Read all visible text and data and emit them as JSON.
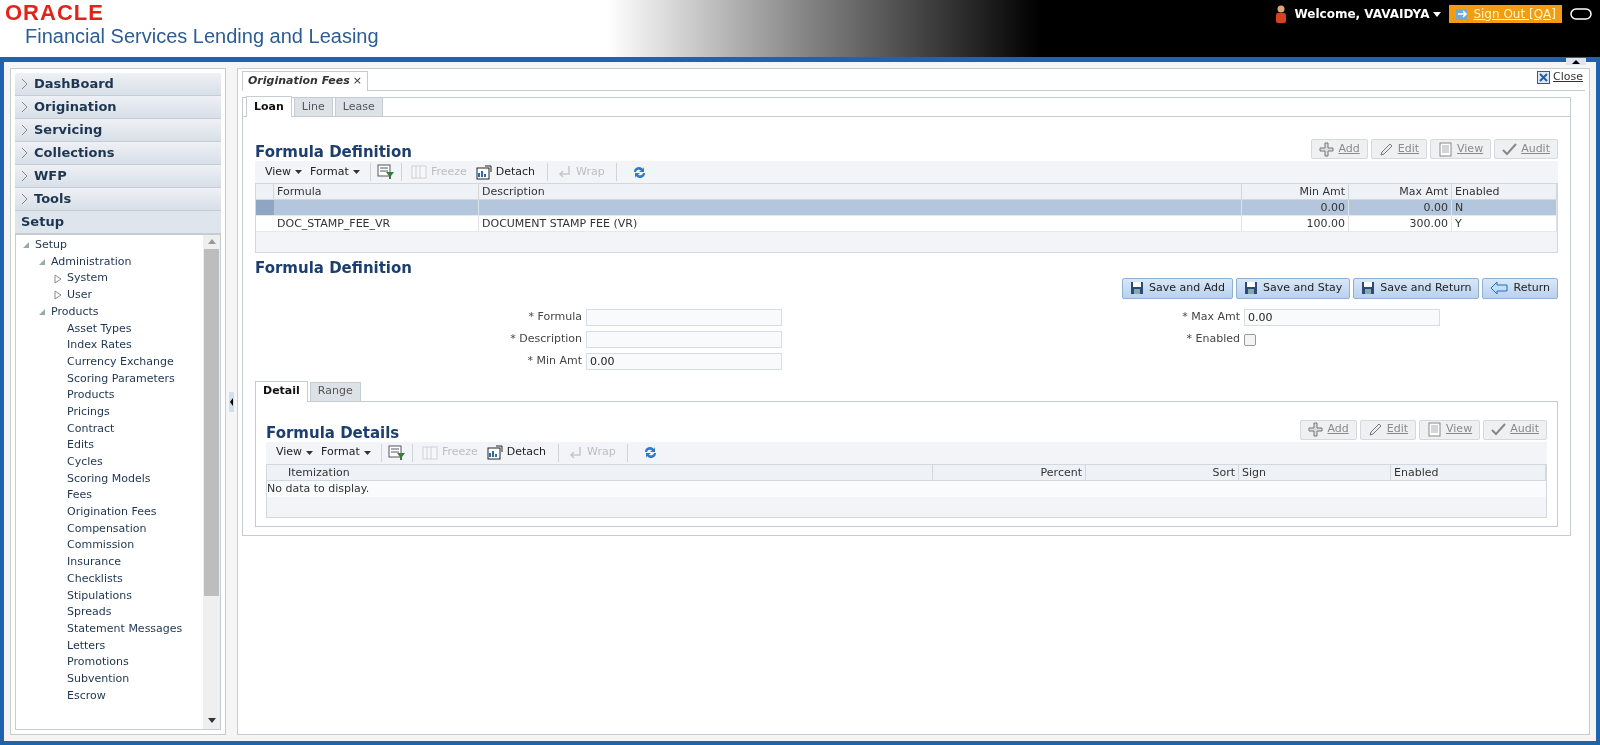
{
  "header": {
    "logo": "ORACLE",
    "product": "Financial Services Lending and Leasing",
    "welcome": "Welcome, VAVAIDYA",
    "sign_out": "Sign Out [QA]"
  },
  "sidebar": {
    "sections": [
      {
        "label": "DashBoard",
        "expanded": false
      },
      {
        "label": "Origination",
        "expanded": false
      },
      {
        "label": "Servicing",
        "expanded": false
      },
      {
        "label": "Collections",
        "expanded": false
      },
      {
        "label": "WFP",
        "expanded": false
      },
      {
        "label": "Tools",
        "expanded": false
      },
      {
        "label": "Setup",
        "expanded": true
      }
    ],
    "tree": [
      {
        "label": "Setup",
        "expanded": true,
        "children": [
          {
            "label": "Administration",
            "expanded": true,
            "children": [
              {
                "label": "System",
                "expanded": false
              },
              {
                "label": "User",
                "expanded": false
              }
            ]
          },
          {
            "label": "Products",
            "expanded": true,
            "children": [
              {
                "label": "Asset Types"
              },
              {
                "label": "Index Rates"
              },
              {
                "label": "Currency Exchange"
              },
              {
                "label": "Scoring Parameters"
              },
              {
                "label": "Products"
              },
              {
                "label": "Pricings"
              },
              {
                "label": "Contract"
              },
              {
                "label": "Edits"
              },
              {
                "label": "Cycles"
              },
              {
                "label": "Scoring Models"
              },
              {
                "label": "Fees"
              },
              {
                "label": "Origination Fees"
              },
              {
                "label": "Compensation"
              },
              {
                "label": "Commission"
              },
              {
                "label": "Insurance"
              },
              {
                "label": "Checklists"
              },
              {
                "label": "Stipulations"
              },
              {
                "label": "Spreads"
              },
              {
                "label": "Statement Messages"
              },
              {
                "label": "Letters"
              },
              {
                "label": "Promotions"
              },
              {
                "label": "Subvention"
              },
              {
                "label": "Escrow"
              }
            ]
          }
        ]
      }
    ]
  },
  "page_tab": {
    "label": "Origination Fees",
    "close": "×"
  },
  "close_link": "Close",
  "tabs": [
    {
      "label": "Loan",
      "selected": true
    },
    {
      "label": "Line",
      "selected": false
    },
    {
      "label": "Lease",
      "selected": false
    }
  ],
  "formula_table": {
    "title": "Formula Definition",
    "actions": [
      {
        "label": "Add",
        "kind": "add",
        "disabled": true
      },
      {
        "label": "Edit",
        "kind": "edit",
        "disabled": true
      },
      {
        "label": "View",
        "kind": "view",
        "disabled": true
      },
      {
        "label": "Audit",
        "kind": "audit",
        "disabled": true
      }
    ],
    "toolbar": [
      {
        "label": "View",
        "kind": "menu",
        "disabled": false
      },
      {
        "label": "Format",
        "kind": "menu",
        "disabled": false
      },
      {
        "kind": "filter"
      },
      {
        "label": "Freeze",
        "kind": "freeze",
        "disabled": true
      },
      {
        "label": "Detach",
        "kind": "detach",
        "disabled": false
      },
      {
        "label": "Wrap",
        "kind": "wrap",
        "disabled": true
      },
      {
        "kind": "refresh"
      }
    ],
    "columns": [
      "Formula",
      "Description",
      "Min Amt",
      "Max Amt",
      "Enabled"
    ],
    "rows": [
      {
        "cells": [
          "",
          "",
          "0.00",
          "0.00",
          "N"
        ],
        "selected": true
      },
      {
        "cells": [
          "DOC_STAMP_FEE_VR",
          "DOCUMENT STAMP FEE (VR)",
          "100.00",
          "300.00",
          "Y"
        ],
        "selected": false
      }
    ]
  },
  "form": {
    "title": "Formula Definition",
    "buttons": [
      {
        "label": "Save and Add",
        "kind": "save"
      },
      {
        "label": "Save and Stay",
        "kind": "save"
      },
      {
        "label": "Save and Return",
        "kind": "save"
      },
      {
        "label": "Return",
        "kind": "return"
      }
    ],
    "left_fields": [
      {
        "label": "* Formula"
      },
      {
        "label": "* Description"
      },
      {
        "label": "* Min Amt",
        "value": "0.00"
      }
    ],
    "right_fields": [
      {
        "label": "* Max Amt",
        "kind": "text",
        "value": "0.00"
      },
      {
        "label": "* Enabled",
        "kind": "checkbox",
        "checked": false
      }
    ]
  },
  "detail_tabs": [
    {
      "label": "Detail",
      "selected": true
    },
    {
      "label": "Range",
      "selected": false
    }
  ],
  "details_table": {
    "title": "Formula Details",
    "actions": [
      {
        "label": "Add",
        "kind": "add",
        "disabled": true
      },
      {
        "label": "Edit",
        "kind": "edit",
        "disabled": true
      },
      {
        "label": "View",
        "kind": "view",
        "disabled": true
      },
      {
        "label": "Audit",
        "kind": "audit",
        "disabled": true
      }
    ],
    "toolbar": [
      {
        "label": "View",
        "kind": "menu",
        "disabled": false
      },
      {
        "label": "Format",
        "kind": "menu",
        "disabled": false
      },
      {
        "kind": "filter"
      },
      {
        "label": "Freeze",
        "kind": "freeze",
        "disabled": true
      },
      {
        "label": "Detach",
        "kind": "detach",
        "disabled": false
      },
      {
        "label": "Wrap",
        "kind": "wrap",
        "disabled": true
      },
      {
        "kind": "refresh"
      }
    ],
    "columns": [
      "Itemization",
      "Percent",
      "Sort",
      "Sign",
      "Enabled"
    ],
    "empty": "No data to display."
  }
}
